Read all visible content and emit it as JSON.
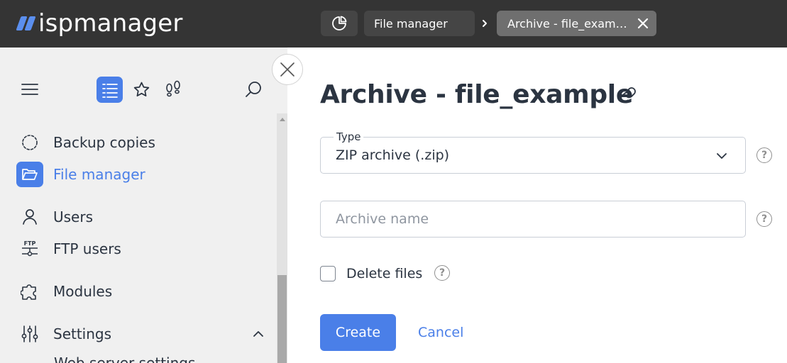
{
  "app": {
    "logo_text": "ispmanager",
    "accent_color": "#4a7fe8",
    "topbar_color": "#343434"
  },
  "breadcrumbs": {
    "home_icon": "dashboard-chart-icon",
    "items": [
      {
        "label": "File manager"
      },
      {
        "label": "Archive - file_examp..."
      }
    ],
    "separator_icon": "chevron-right-icon",
    "close_icon": "close-icon"
  },
  "sidebar": {
    "toolbar": {
      "menu_icon": "hamburger-icon",
      "list_icon": "list-view-icon",
      "star_icon": "star-icon",
      "steps_icon": "footsteps-icon",
      "search_icon": "search-icon"
    },
    "items": [
      {
        "label": "Backup copies",
        "icon": "backup-icon"
      },
      {
        "label": "File manager",
        "icon": "folder-open-icon",
        "active": true
      },
      {
        "label": "Users",
        "icon": "user-icon"
      },
      {
        "label": "FTP users",
        "icon": "ftp-icon"
      },
      {
        "label": "Modules",
        "icon": "puzzle-icon"
      },
      {
        "label": "Settings",
        "icon": "sliders-icon",
        "expanded": true
      }
    ],
    "cut_item_label": "Web server settings"
  },
  "form": {
    "title": "Archive - file_example",
    "link_icon": "link-icon",
    "type_field": {
      "legend": "Type",
      "selected": "ZIP archive (.zip)"
    },
    "name_field": {
      "placeholder": "Archive name",
      "value": ""
    },
    "delete_files": {
      "label": "Delete files",
      "checked": false
    },
    "help_glyph": "?",
    "create_label": "Create",
    "cancel_label": "Cancel"
  }
}
